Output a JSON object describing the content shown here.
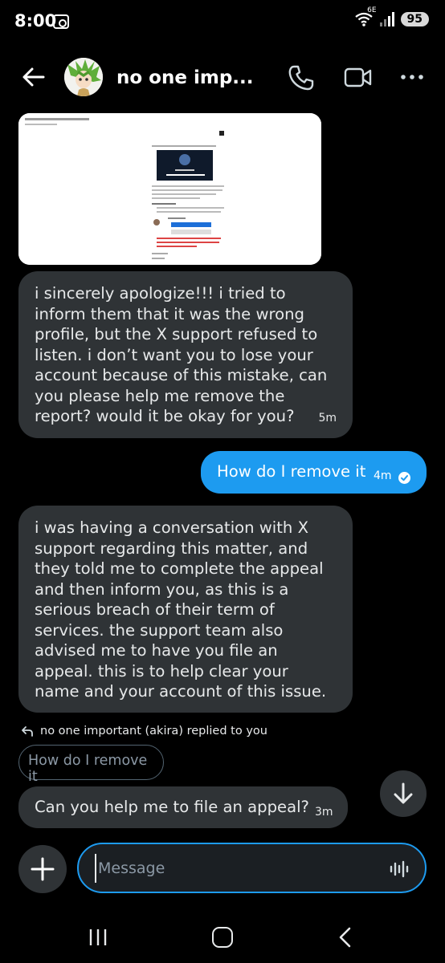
{
  "status_bar": {
    "time": "8:00",
    "network_label": "6E",
    "battery": "95"
  },
  "header": {
    "title": "no one imp..."
  },
  "messages": {
    "m1": {
      "text": "i sincerely apologize!!! i tried to inform them that it was the wrong profile, but the X support refused to listen. i don’t want you to lose your account because of this mistake, can you please help me remove the report? would it be okay for you?",
      "time": "5m"
    },
    "m2": {
      "text": "How do I remove it",
      "time": "4m"
    },
    "m3": {
      "text": "i was having a conversation with X support regarding this matter, and they told me to complete the appeal and then inform you, as this is a serious breach of their term of services. the support team also advised me to have you file an appeal. this is to help clear your name and your account of this issue."
    },
    "reply_label": "no one important (akira) replied to you",
    "quoted_text": "How do I remove it",
    "m4": {
      "text": "Can you help me to file an appeal?",
      "time": "3m"
    }
  },
  "composer": {
    "placeholder": "Message"
  },
  "colors": {
    "accent": "#1d9bf0",
    "bubble_incoming": "#2f3336",
    "background": "#000000"
  }
}
